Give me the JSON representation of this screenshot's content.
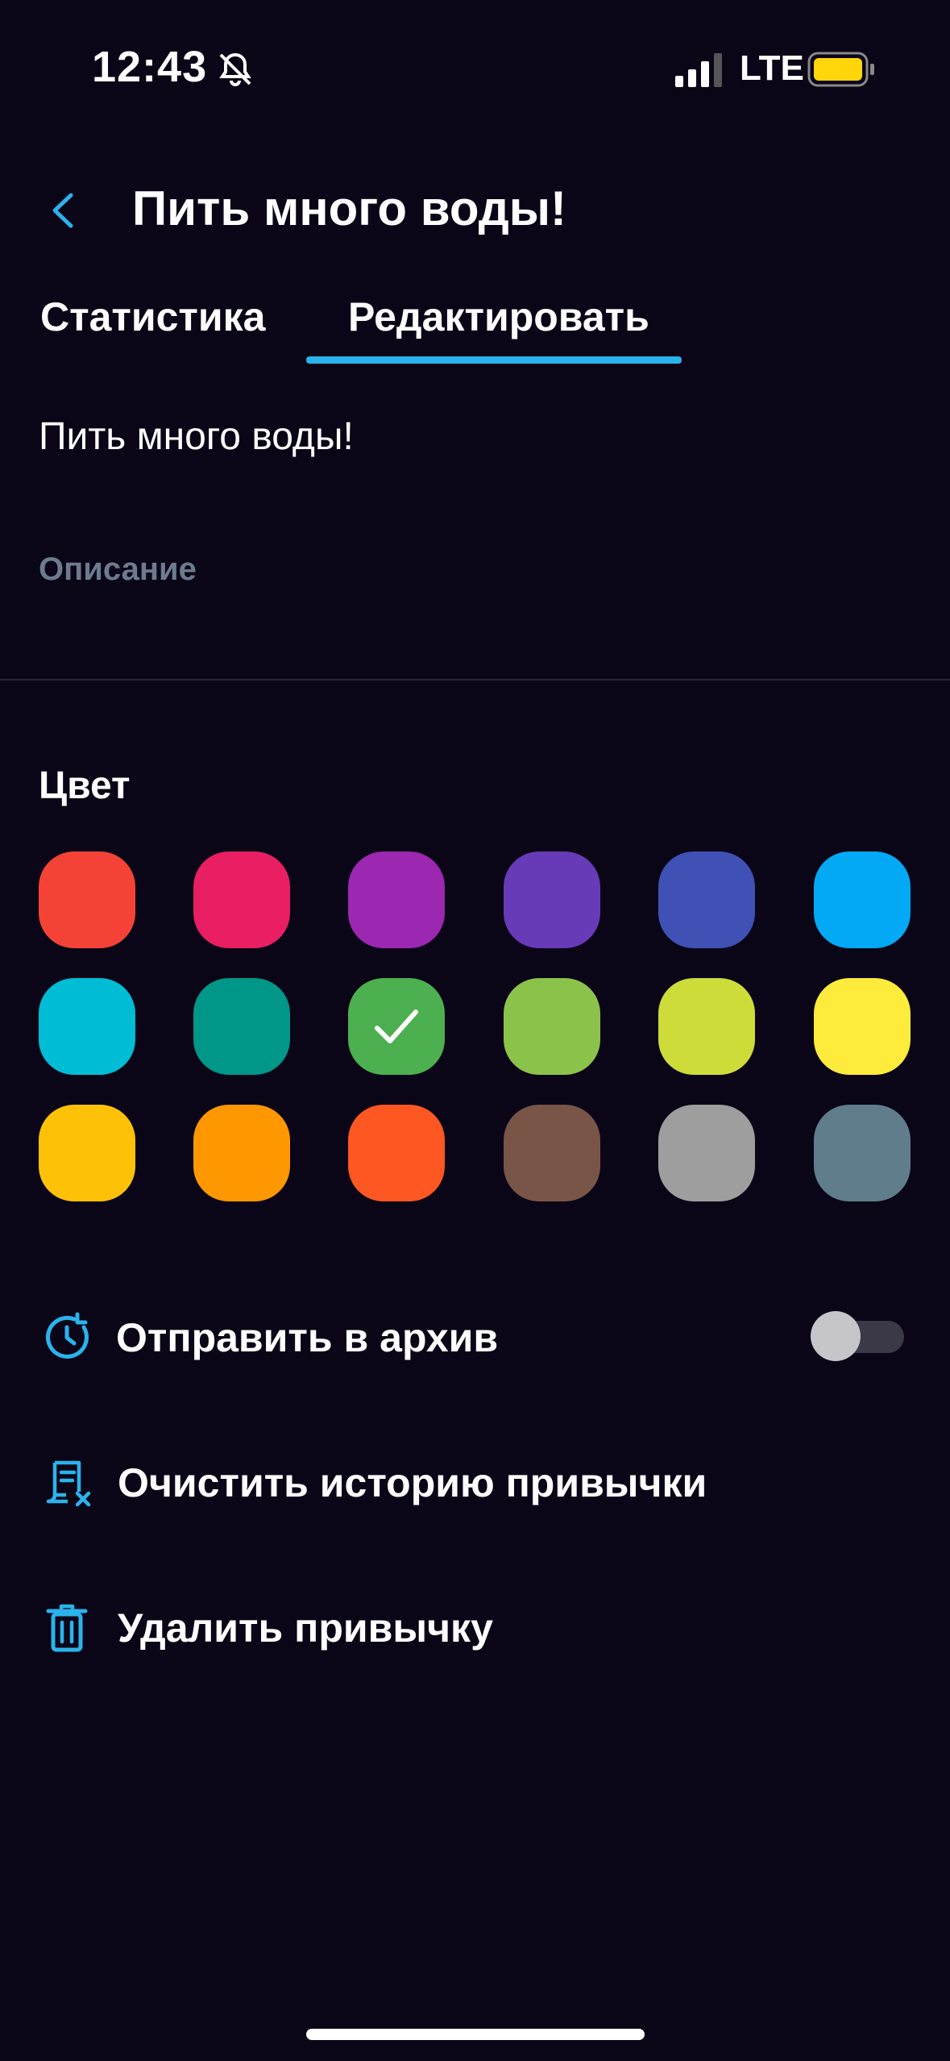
{
  "status_bar": {
    "time": "12:43",
    "network": "LTE",
    "battery_color": "#ffd60a"
  },
  "header": {
    "title": "Пить много воды!",
    "back_icon": "chevron-left-icon"
  },
  "tabs": [
    {
      "label": "Статистика",
      "active": false
    },
    {
      "label": "Редактировать",
      "active": true
    }
  ],
  "form": {
    "name_value": "Пить много воды!",
    "description_placeholder": "Описание"
  },
  "colors": {
    "heading": "Цвет",
    "swatches": [
      "#f44336",
      "#e91e63",
      "#9c27b0",
      "#673ab7",
      "#3f51b5",
      "#03a9f4",
      "#00bcd4",
      "#009688",
      "#4caf50",
      "#8bc34a",
      "#cddc39",
      "#ffeb3b",
      "#ffc107",
      "#ff9800",
      "#ff5722",
      "#795548",
      "#9e9e9e",
      "#607d8b"
    ],
    "selected_index": 8
  },
  "actions": {
    "archive": {
      "label": "Отправить в архив",
      "icon": "archive-clock-icon",
      "toggle_on": false
    },
    "clear_history": {
      "label": "Очистить историю привычки",
      "icon": "clear-history-icon"
    },
    "delete": {
      "label": "Удалить привычку",
      "icon": "trash-icon"
    }
  },
  "accent_color": "#2ab3ec",
  "background_color": "#0a0617"
}
